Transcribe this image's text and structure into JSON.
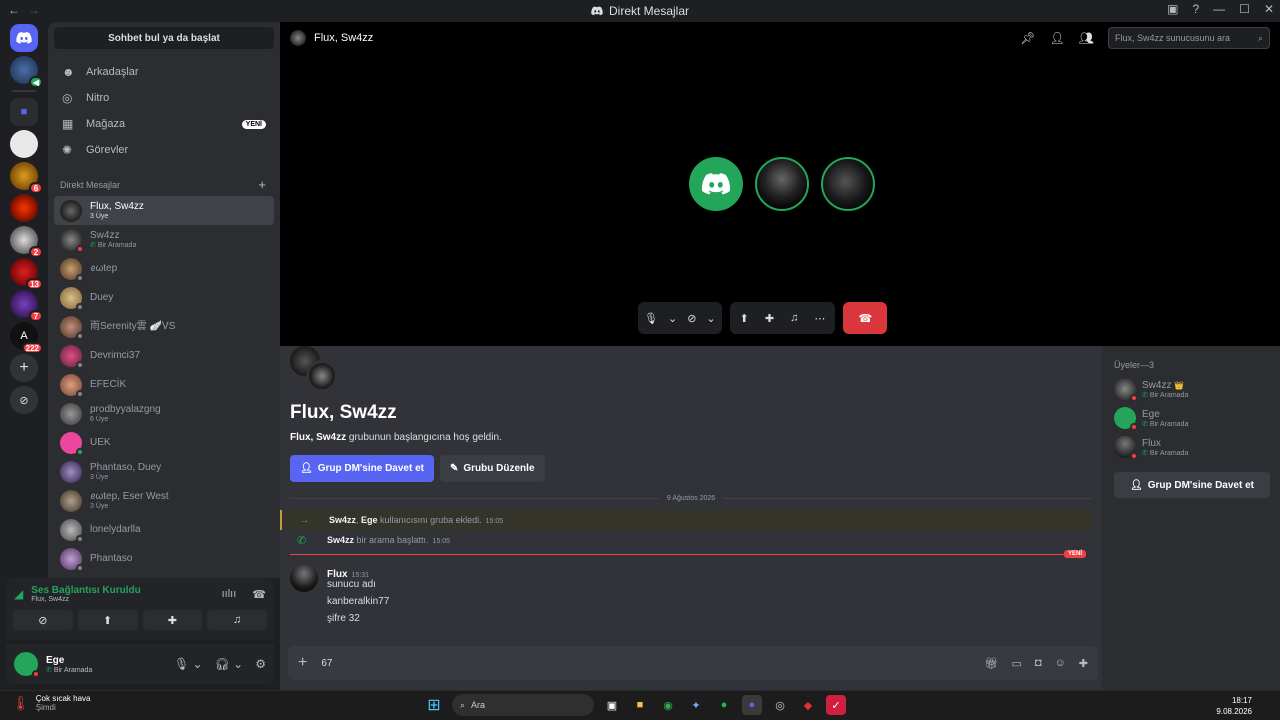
{
  "titlebar": {
    "title": "Direkt Mesajlar"
  },
  "rail": {
    "servers": [
      {
        "name": "server-home",
        "badge": ""
      },
      {
        "name": "server-1",
        "badge": ""
      },
      {
        "name": "server-2",
        "badge": ""
      },
      {
        "name": "server-3",
        "badge": "6"
      },
      {
        "name": "server-4",
        "badge": ""
      },
      {
        "name": "server-5",
        "badge": "2"
      },
      {
        "name": "server-6",
        "badge": "13"
      },
      {
        "name": "server-7",
        "badge": "7"
      },
      {
        "name": "server-8",
        "badge": "222"
      }
    ]
  },
  "sidebar": {
    "find_label": "Sohbet bul ya da başlat",
    "nav": [
      {
        "label": "Arkadaşlar",
        "icon": "friends-icon"
      },
      {
        "label": "Nitro",
        "icon": "nitro-icon"
      },
      {
        "label": "Mağaza",
        "icon": "shop-icon",
        "badge": "YENİ"
      },
      {
        "label": "Görevler",
        "icon": "quests-icon"
      }
    ],
    "dm_header": "Direkt Mesajlar",
    "dms": [
      {
        "name": "Flux, Sw4zz",
        "sub": "3 Üye",
        "active": true
      },
      {
        "name": "Sw4zz",
        "sub": "Bir Aramada"
      },
      {
        "name": "ꫀωtep",
        "sub": ""
      },
      {
        "name": "Duey",
        "sub": ""
      },
      {
        "name": "雨Serenity雲 🪽ᐯS",
        "sub": ""
      },
      {
        "name": "Devrimci37",
        "sub": ""
      },
      {
        "name": "EFECİK",
        "sub": ""
      },
      {
        "name": "prodbyyalazgng",
        "sub": "6 Üye"
      },
      {
        "name": "UEK",
        "sub": ""
      },
      {
        "name": "Phantaso, Duey",
        "sub": "3 Üye"
      },
      {
        "name": "ꫀωtep, Eser West",
        "sub": "3 Üye"
      },
      {
        "name": "lonelydarlla",
        "sub": ""
      },
      {
        "name": "Phantaso",
        "sub": ""
      }
    ]
  },
  "voice": {
    "title": "Ses Bağlantısı Kuruldu",
    "channel": "Flux, Sw4zz"
  },
  "user": {
    "name": "Ege",
    "status": "Bir Aramada"
  },
  "call": {
    "title": "Flux, Sw4zz",
    "search_placeholder": "Flux, Sw4zz sunucusunu ara"
  },
  "chat": {
    "group_title": "Flux, Sw4zz",
    "welcome_name": "Flux, Sw4zz",
    "welcome_text": " grubunun başlangıcına hoş geldin.",
    "invite_btn": "Grup DM'sine Davet et",
    "edit_btn": "Grubu Düzenle",
    "date": "9 Ağustos 2026",
    "sys1": {
      "a": "Sw4zz",
      "sep": ", ",
      "b": "Ege",
      "text": " kullanıcısını gruba ekledi.",
      "time": "15:05"
    },
    "sys2": {
      "a": "Sw4zz",
      "text": " bir arama başlattı.",
      "time": "15:05"
    },
    "new_tag": "YENİ",
    "message": {
      "author": "Flux",
      "time": "15:31",
      "lines": [
        "sunucu adı",
        "kanberalkin77",
        "şifre 32"
      ]
    },
    "composer_value": "67"
  },
  "members": {
    "header": "Üyeler—3",
    "list": [
      {
        "name": "Sw4zz",
        "status": "Bir Aramada",
        "owner": "👑"
      },
      {
        "name": "Ege",
        "status": "Bir Aramada"
      },
      {
        "name": "Flux",
        "status": "Bir Aramada"
      }
    ],
    "invite_btn": "Grup DM'sine Davet et"
  },
  "taskbar": {
    "weather_title": "Çok sıcak hava",
    "weather_sub": "Şimdi",
    "search": "Ara",
    "time": "18:17",
    "date": "9.08.2026"
  }
}
